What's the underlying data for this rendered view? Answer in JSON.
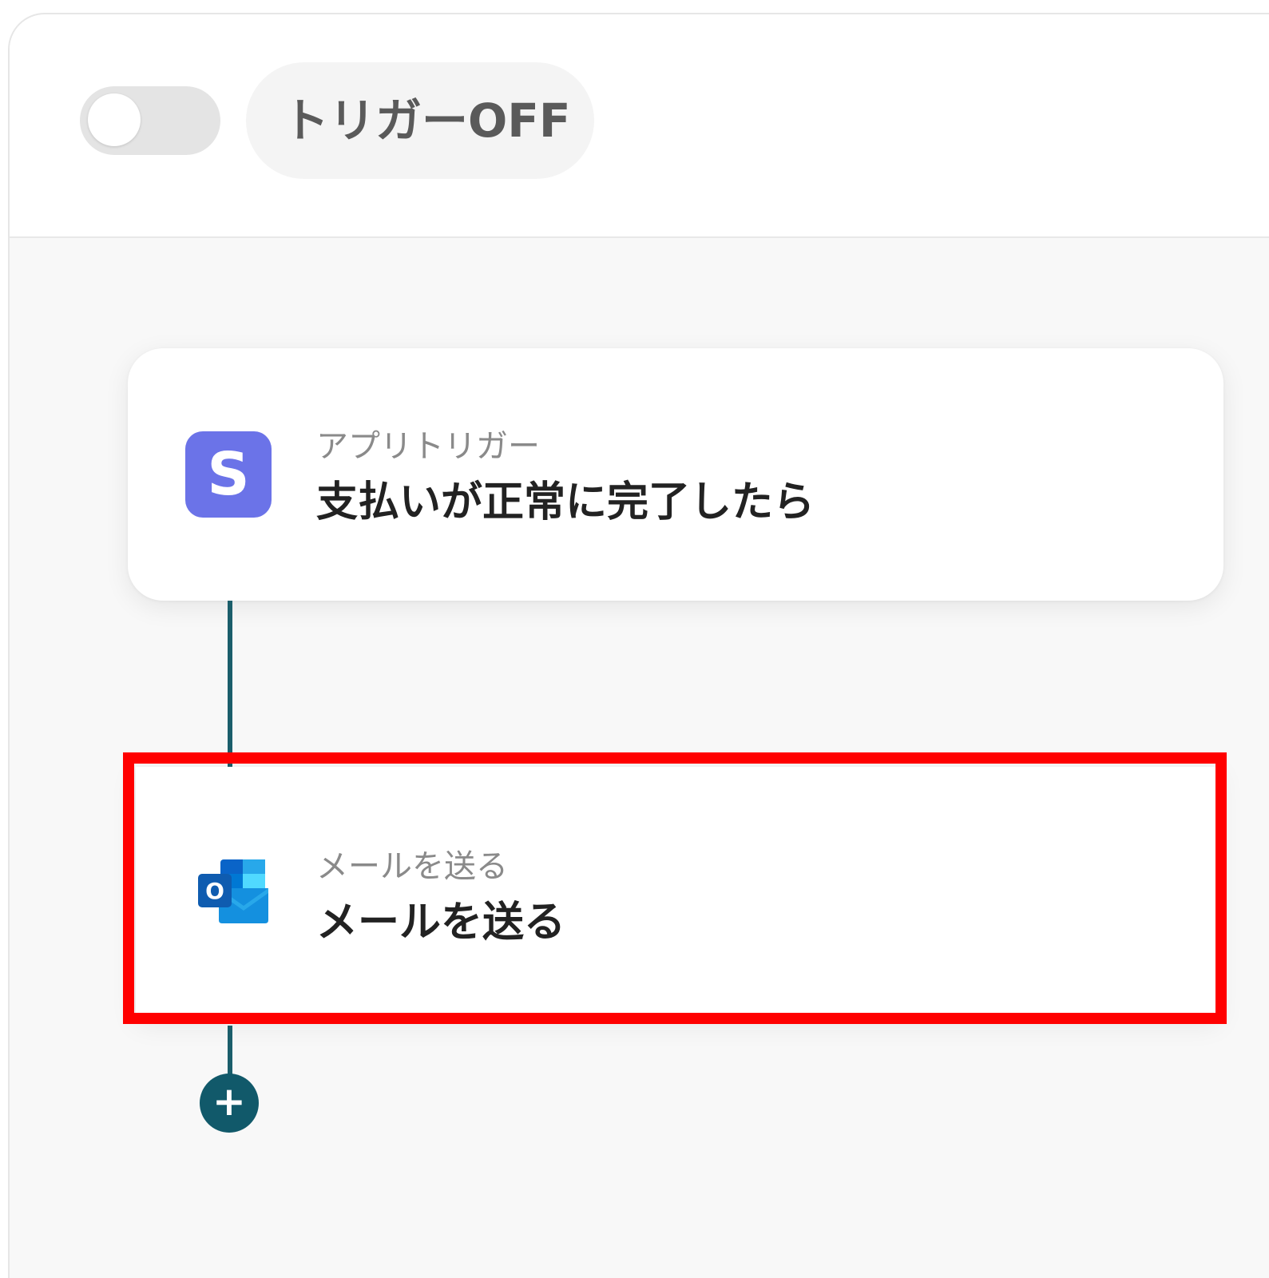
{
  "header": {
    "trigger_status": "トリガーOFF"
  },
  "flow": {
    "steps": [
      {
        "subtitle": "アプリトリガー",
        "title": "支払いが正常に完了したら",
        "icon": "stripe-icon",
        "icon_letter": "S"
      },
      {
        "subtitle": "メールを送る",
        "title": "メールを送る",
        "icon": "outlook-icon",
        "icon_letter": "O"
      }
    ],
    "add_button_glyph": "+"
  },
  "colors": {
    "stripe": "#6b73e8",
    "connector": "#1b5e6b",
    "add_button": "#11596a",
    "highlight": "#ff0000",
    "outlook_blue": "#0a64c8"
  }
}
